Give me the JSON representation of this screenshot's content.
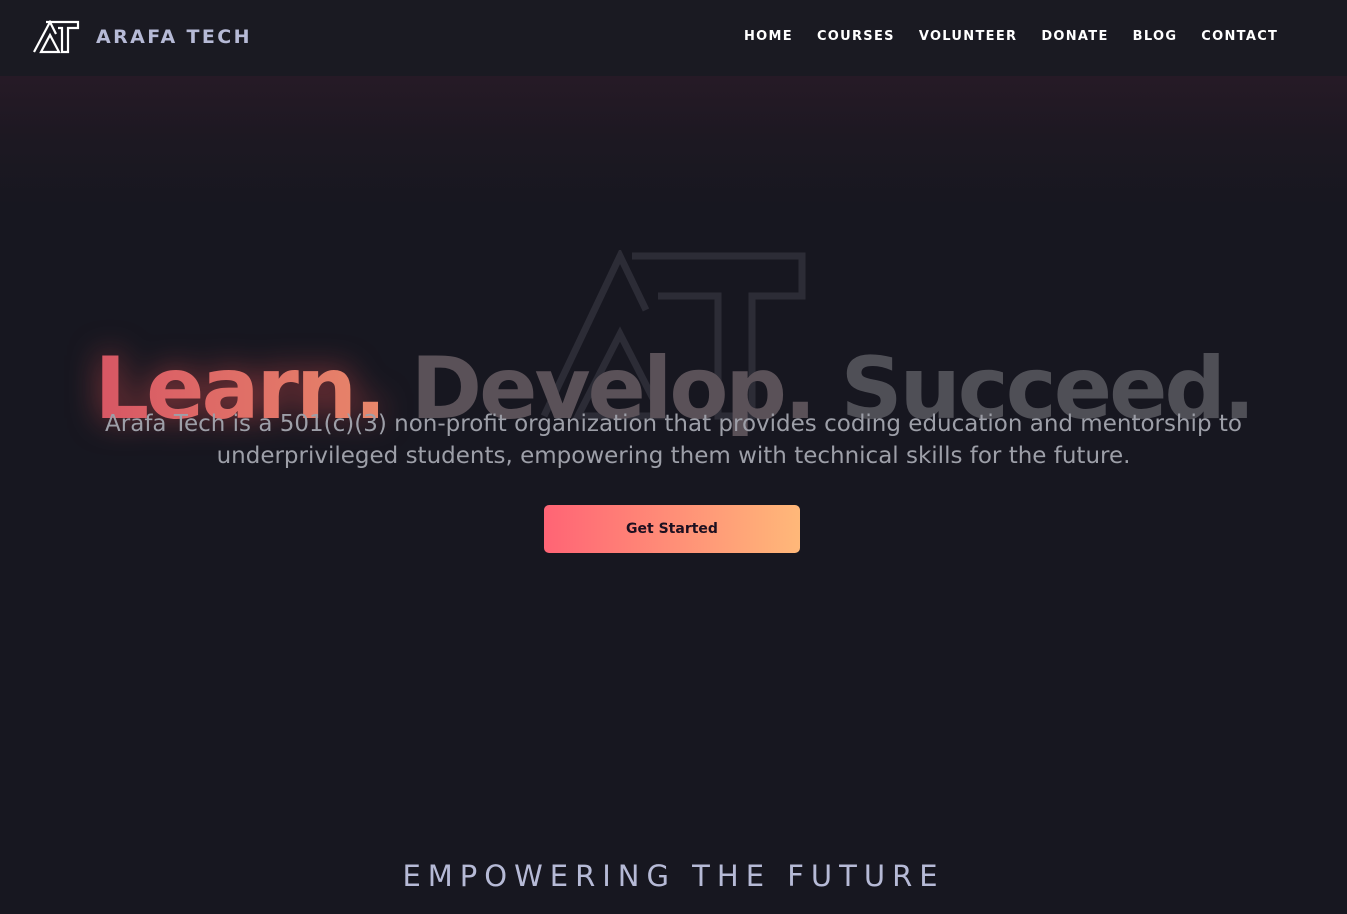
{
  "brand": {
    "name": "ARAFA TECH",
    "logo_icon": "at-monogram-logo"
  },
  "nav": {
    "items": [
      {
        "label": "HOME"
      },
      {
        "label": "COURSES"
      },
      {
        "label": "VOLUNTEER"
      },
      {
        "label": "DONATE"
      },
      {
        "label": "BLOG"
      },
      {
        "label": "CONTACT"
      }
    ]
  },
  "hero": {
    "headline": {
      "word1": "Learn.",
      "word2": "Develop.",
      "word3": "Succeed."
    },
    "subtitle": "Arafa Tech is a 501(c)(3) non-profit organization that provides coding education and mentorship to underprivileged students, empowering them with technical skills for the future.",
    "cta_label": "Get Started",
    "watermark_icon": "at-monogram-watermark"
  },
  "section": {
    "title": "EMPOWERING THE FUTURE"
  },
  "colors": {
    "background": "#171720",
    "navbar": "#1a1a22",
    "brand_text": "#b6bad6",
    "accent_start": "#ff6475",
    "accent_end": "#ffb879"
  }
}
